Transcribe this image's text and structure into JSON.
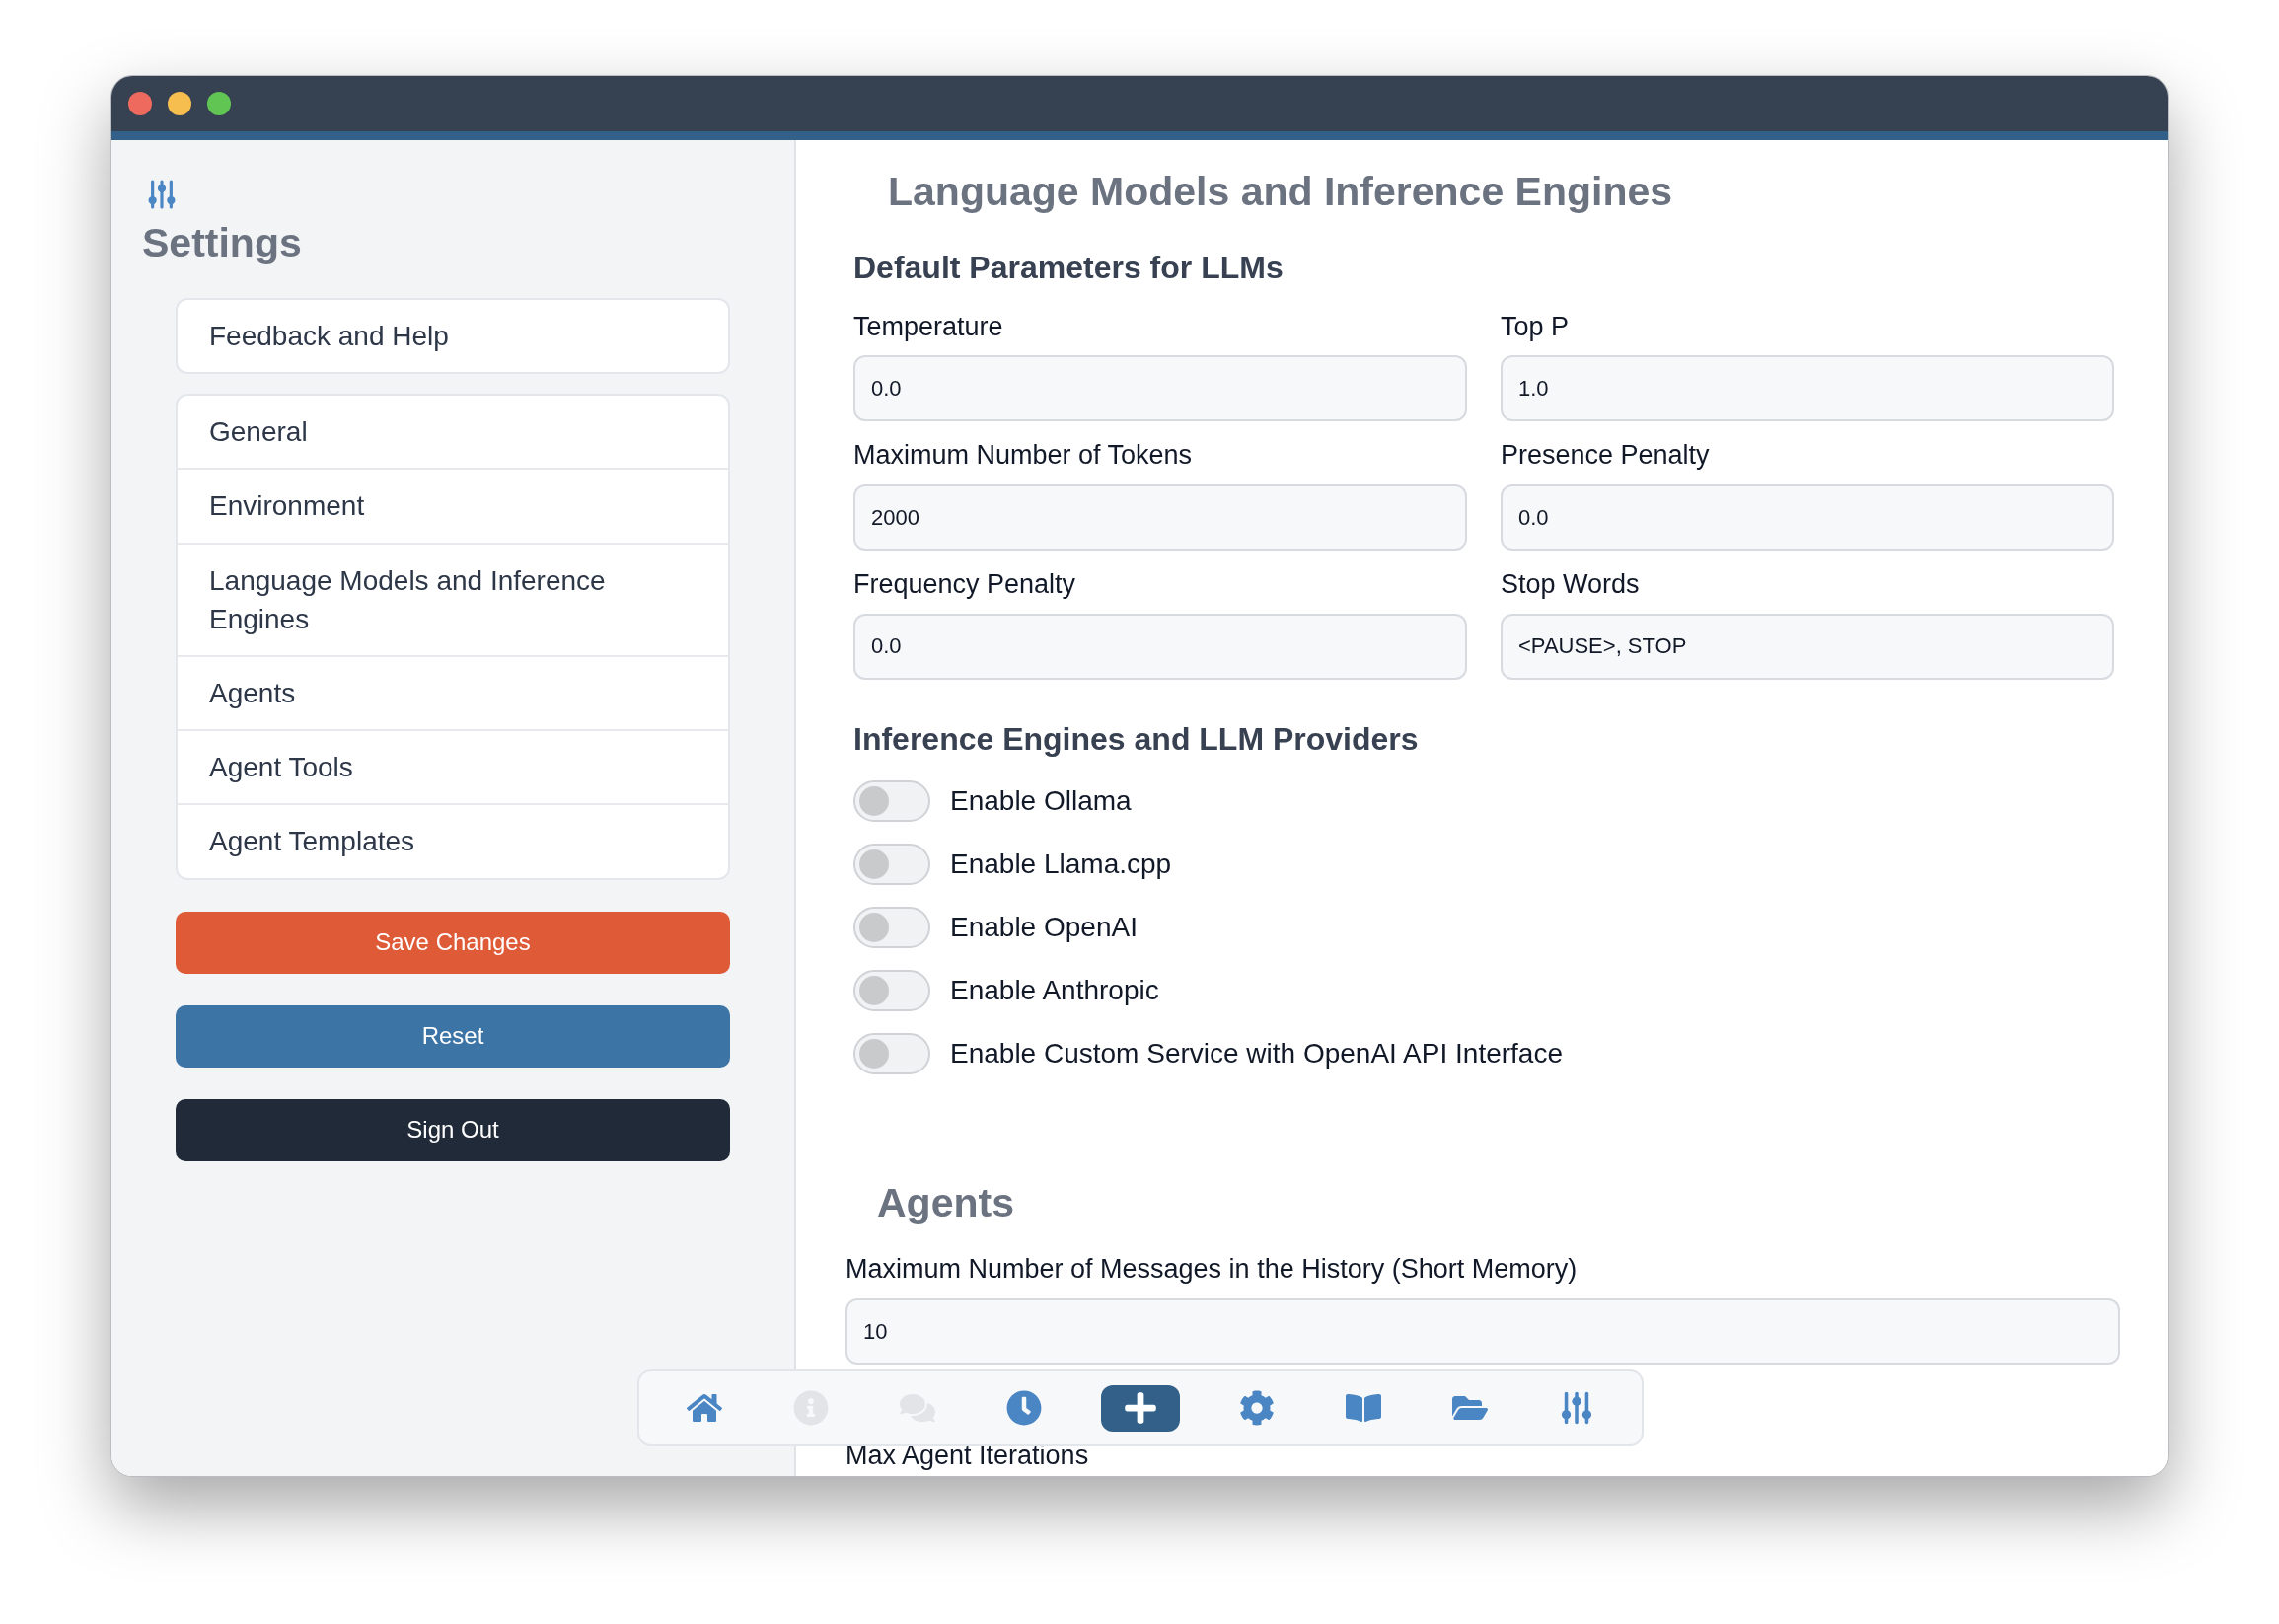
{
  "sidebar": {
    "title": "Settings",
    "top_items": [
      {
        "label": "Feedback and Help"
      }
    ],
    "items": [
      {
        "label": "General"
      },
      {
        "label": "Environment"
      },
      {
        "label": "Language Models and Inference Engines"
      },
      {
        "label": "Agents"
      },
      {
        "label": "Agent Tools"
      },
      {
        "label": "Agent Templates"
      }
    ],
    "buttons": [
      {
        "label": "Save Changes",
        "kind": "primary"
      },
      {
        "label": "Reset",
        "kind": "secondary"
      },
      {
        "label": "Sign Out",
        "kind": "dark"
      }
    ]
  },
  "main": {
    "title": "Language Models and Inference Engines",
    "defaults": {
      "heading": "Default Parameters for LLMs",
      "fields": [
        {
          "label": "Temperature",
          "value": "0.0"
        },
        {
          "label": "Top P",
          "value": "1.0"
        },
        {
          "label": "Maximum Number of Tokens",
          "value": "2000"
        },
        {
          "label": "Presence Penalty",
          "value": "0.0"
        },
        {
          "label": "Frequency Penalty",
          "value": "0.0"
        },
        {
          "label": "Stop Words",
          "value": "<PAUSE>, STOP"
        }
      ]
    },
    "providers": {
      "heading": "Inference Engines and LLM Providers",
      "toggles": [
        {
          "label": "Enable Ollama",
          "on": false
        },
        {
          "label": "Enable Llama.cpp",
          "on": false
        },
        {
          "label": "Enable OpenAI",
          "on": false
        },
        {
          "label": "Enable Anthropic",
          "on": false
        },
        {
          "label": "Enable Custom Service with OpenAI API Interface",
          "on": false
        }
      ]
    },
    "agents": {
      "title": "Agents",
      "fields": [
        {
          "label": "Maximum Number of Messages in the History (Short Memory)",
          "value": "10"
        }
      ],
      "next_label": "Max Agent Iterations"
    }
  },
  "nav": [
    {
      "kind": "home",
      "disabled": false,
      "selected": false
    },
    {
      "kind": "info",
      "disabled": true,
      "selected": false
    },
    {
      "kind": "chat",
      "disabled": true,
      "selected": false
    },
    {
      "kind": "clock",
      "disabled": false,
      "selected": false
    },
    {
      "kind": "plus",
      "disabled": false,
      "selected": true
    },
    {
      "kind": "gear",
      "disabled": false,
      "selected": false
    },
    {
      "kind": "book",
      "disabled": false,
      "selected": false
    },
    {
      "kind": "folder",
      "disabled": false,
      "selected": false
    },
    {
      "kind": "sliders",
      "disabled": false,
      "selected": false
    }
  ]
}
